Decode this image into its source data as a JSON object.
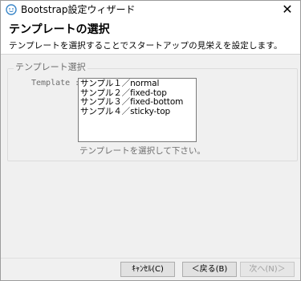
{
  "window": {
    "title": "Bootstrap設定ウィザード",
    "close_glyph": "✕"
  },
  "header": {
    "title": "テンプレートの選択",
    "description": "テンプレートを選択することでスタートアップの見栄えを設定します。"
  },
  "group": {
    "legend": "テンプレート選択",
    "template_label": "Template :",
    "items": [
      "サンプル１／normal",
      "サンプル２／fixed-top",
      "サンプル３／fixed-bottom",
      "サンプル４／sticky-top"
    ]
  },
  "hint": "テンプレートを選択して下さい。",
  "buttons": {
    "cancel": "ｷｬﾝｾﾙ(C)",
    "back": "＜戻る(B)",
    "next": "次へ(N)＞"
  },
  "colors": {
    "app_icon": "#3a86c8"
  }
}
